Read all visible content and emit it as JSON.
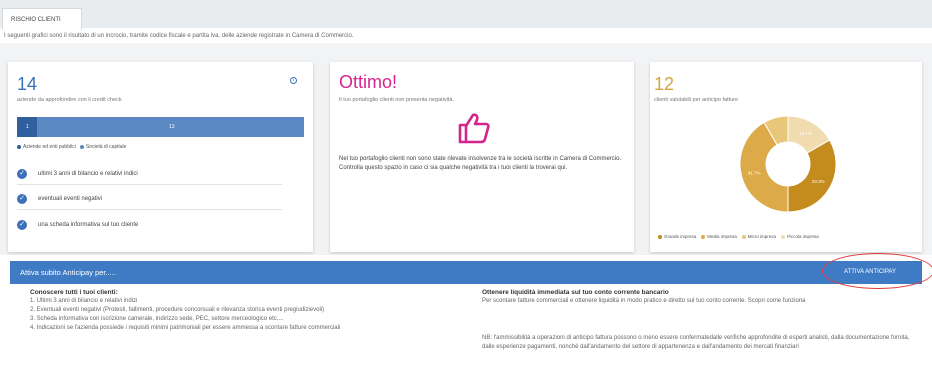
{
  "tab": {
    "label": "RISCHIO CLIENTI"
  },
  "intro": "I seguenti grafici sono il risultato di un incrocio, tramite codice fiscale e partita iva, delle aziende registrate in Camera di Commercio.",
  "card1": {
    "count": "14",
    "subtitle": "aziende da approfondire con il credit check",
    "bar": {
      "public_value": "1",
      "company_value": "13",
      "public_share": 0.071
    },
    "legend": [
      "Aziende ed enti pubblici",
      "Società di capitale"
    ],
    "checks": [
      "ultimi 3 anni di bilancio e relativi indici",
      "eventuali eventi negativi",
      "una scheda informativa sul tuo cliente"
    ],
    "info_icon": "info-icon"
  },
  "card2": {
    "title": "Ottimo!",
    "subtitle": "Il tuo portafoglio clienti non presenta negatività.",
    "icon": "thumbs-up-icon",
    "text": "Nel tuo portafoglio clienti non sono state rilevate insolvenze tra le società iscritte in Camera di Commercio. Controlla questo spazio in caso ci sia qualche negatività tra i tuoi clienti la troverai qui."
  },
  "card3": {
    "count": "12",
    "subtitle": "clienti valutabili per anticipo fatture"
  },
  "chart_data": {
    "type": "pie",
    "categories": [
      "Grande impresa",
      "Media impresa",
      "Micro impresa",
      "Piccola impresa"
    ],
    "values": [
      33.3,
      41.7,
      8.3,
      16.7
    ],
    "labels": [
      "33.3%",
      "41.7%",
      "",
      "16.7%"
    ],
    "colors": [
      "#c48b1d",
      "#dcaa48",
      "#e8c77a",
      "#f0dcae"
    ]
  },
  "banner": {
    "title": "Attiva subito Anticipay per.....",
    "button": "ATTIVA ANTICIPAY"
  },
  "left_col": {
    "title": "Conoscere tutti i tuoi clienti:",
    "items": [
      "1. Ultimi 3 anni di bilancio e relativi indizi",
      "2. Eventuali eventi negativi (Protesti, fallimenti, procedure concorsuali e rilevanza storica eventi pregiudizievoli)",
      "3. Scheda informativa con iscrizione camerale, indirizzo sede, PEC, settore merceologico etc....",
      "4. Indicazioni se l'azienda possiede i requisiti minimi patrimoniali per essere ammessa a scontare fatture commerciali"
    ]
  },
  "right_col": {
    "title": "Ottenere liquidità immediata sul tuo conto corrente bancario",
    "text": "Per scontare fatture commerciali e ottenere liquidità in modo pratico e diretto sul tuo conto corrente. Scopri come funziona",
    "note": "NB: l'ammissibilità a operazioni di anticipo fattura possono o meno essere confermatedalle verifiche approfondite di esperti analisti, dalla documentazione fornita, dalle esperienze pagamenti, nonché dall'andamento del settore di appartenenza e dall'andamento dei mercati finanziari"
  }
}
